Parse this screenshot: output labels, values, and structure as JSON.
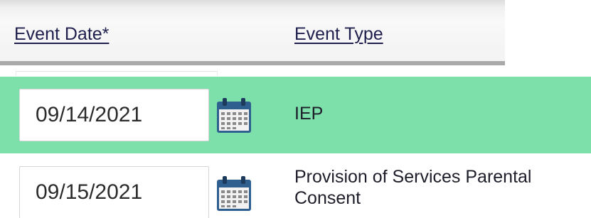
{
  "header": {
    "event_date_label": "Event Date*",
    "event_type_label": "Event Type"
  },
  "rows": [
    {
      "date": "09/14/2021",
      "event_type": "IEP",
      "highlighted": true,
      "highlight_color": "#7ddfaa",
      "calendar_icon": "calendar-icon"
    },
    {
      "date": "09/15/2021",
      "event_type_line1": "Provision of Services Parental",
      "event_type_line2": "Consent",
      "highlighted": false,
      "calendar_icon": "calendar-icon"
    }
  ],
  "colors": {
    "header_link": "#1f1f4d",
    "selected_row": "#7ddfaa",
    "calendar_blue": "#2f5f8f"
  }
}
